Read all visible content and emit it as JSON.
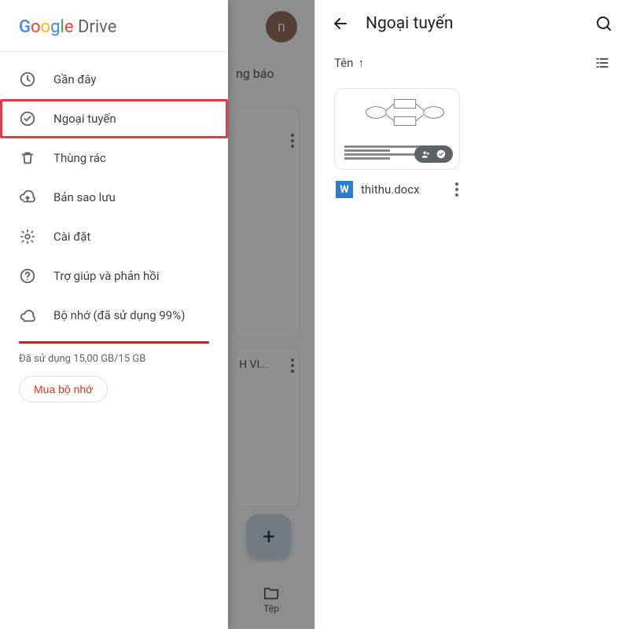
{
  "brand": {
    "name_prefix": "G",
    "name_rest_1": "o",
    "name_rest_2": "o",
    "name_rest_3": "g",
    "name_rest_4": "l",
    "name_rest_5": "e",
    "product": " Drive"
  },
  "drawer": {
    "items": [
      {
        "icon": "clock-icon",
        "label": "Gần đây"
      },
      {
        "icon": "offline-icon",
        "label": "Ngoại tuyến",
        "highlight": true
      },
      {
        "icon": "trash-icon",
        "label": "Thùng rác"
      },
      {
        "icon": "backup-icon",
        "label": "Bản sao lưu"
      },
      {
        "icon": "gear-icon",
        "label": "Cài đặt"
      },
      {
        "icon": "help-icon",
        "label": "Trợ giúp và phản hồi"
      },
      {
        "icon": "cloud-icon",
        "label": "Bộ nhớ (đã sử dụng 99%)"
      }
    ],
    "storage_text": "Đã sử dụng 15,00 GB/15 GB",
    "buy_label": "Mua bộ nhớ"
  },
  "behind": {
    "avatar_letter": "n",
    "notif_label": "ng báo",
    "card2_label": "H VI...",
    "fab_plus": "+",
    "bottom_tab_label": "Tệp"
  },
  "offline_screen": {
    "title": "Ngoại tuyến",
    "sort_label": "Tên",
    "sort_direction": "↑",
    "file": {
      "name": "thithu.docx",
      "type_glyph": "W"
    }
  }
}
